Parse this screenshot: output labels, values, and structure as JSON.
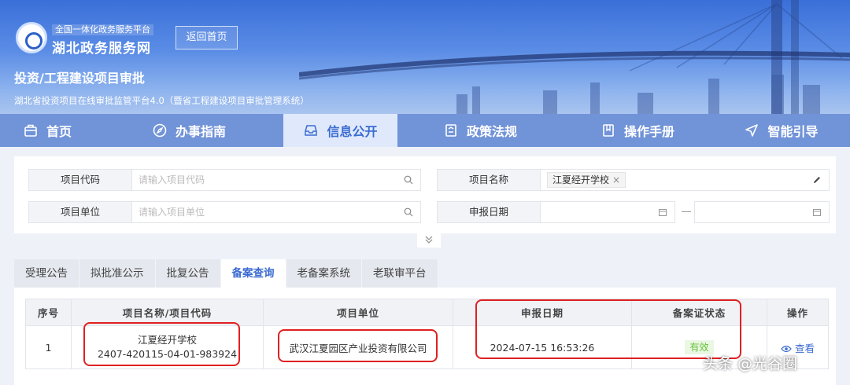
{
  "header": {
    "logo_sub": "全国一体化政务服务平台",
    "logo_main": "湖北政务服务网",
    "back_label": "返回首页",
    "system_title": "投资/工程建设项目审批",
    "system_desc": "湖北省投资项目在线审批监管平台4.0（暨省工程建设项目审批管理系统）"
  },
  "nav": [
    {
      "label": "首页",
      "icon": "home-icon"
    },
    {
      "label": "办事指南",
      "icon": "compass-icon"
    },
    {
      "label": "信息公开",
      "icon": "inbox-icon"
    },
    {
      "label": "政策法规",
      "icon": "document-icon"
    },
    {
      "label": "操作手册",
      "icon": "book-icon"
    },
    {
      "label": "智能引导",
      "icon": "navigation-icon"
    }
  ],
  "filter": {
    "code_label": "项目代码",
    "code_placeholder": "请输入项目代码",
    "name_label": "项目名称",
    "name_tag": "江夏经开学校",
    "unit_label": "项目单位",
    "unit_placeholder": "请输入项目单位",
    "date_label": "申报日期"
  },
  "tabs": [
    "受理公告",
    "拟批准公示",
    "批复公告",
    "备案查询",
    "老备案系统",
    "老联审平台"
  ],
  "table": {
    "headers": [
      "序号",
      "项目名称/项目代码",
      "项目单位",
      "申报日期",
      "备案证状态",
      "操作"
    ],
    "rows": [
      {
        "index": "1",
        "name": "江夏经开学校",
        "code": "2407-420115-04-01-983924",
        "unit": "武汉江夏园区产业投资有限公司",
        "date": "2024-07-15 16:53:26",
        "status": "有效",
        "action": "查看"
      }
    ]
  },
  "watermark": "头条 @光谷圈",
  "colors": {
    "accent": "#3b6cd1",
    "status_ok": "#67c23a",
    "highlight": "#e02020"
  }
}
